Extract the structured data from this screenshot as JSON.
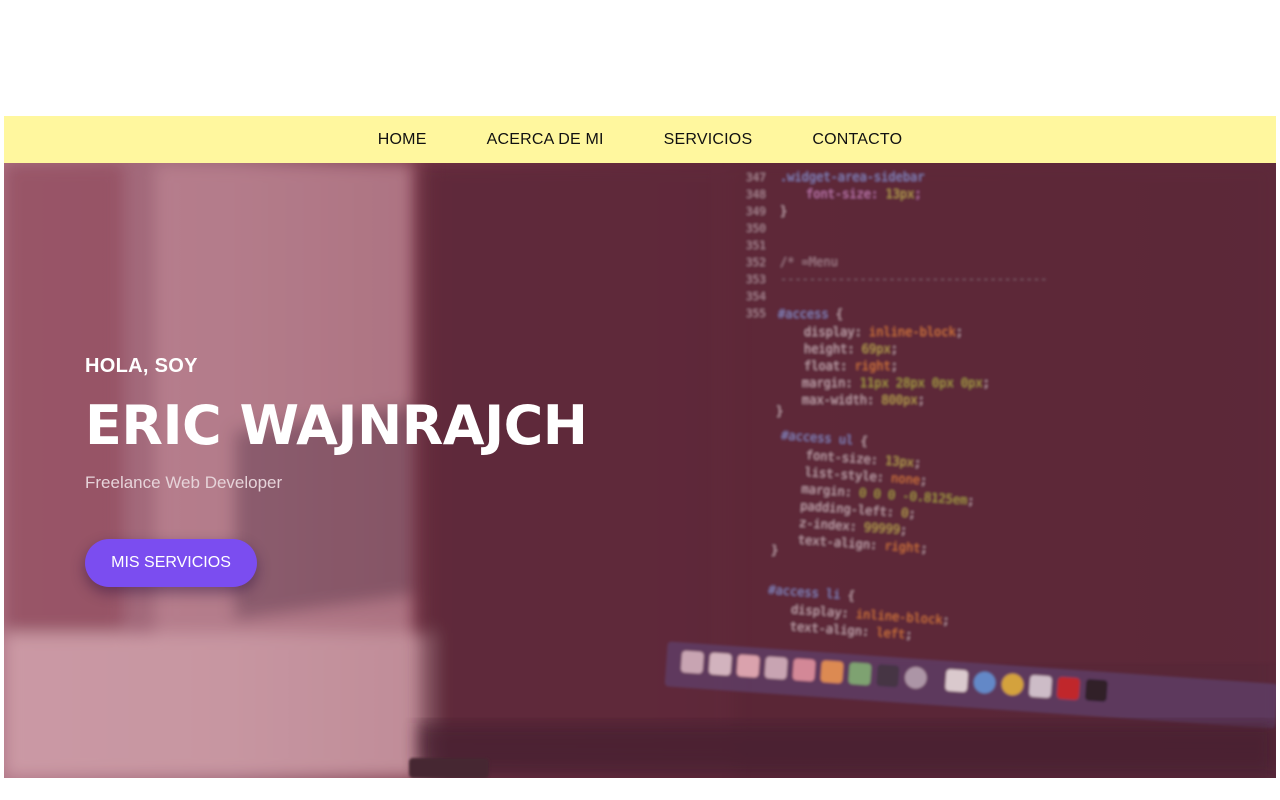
{
  "nav": {
    "items": [
      {
        "label": "HOME"
      },
      {
        "label": "ACERCA DE MI"
      },
      {
        "label": "SERVICIOS"
      },
      {
        "label": "CONTACTO"
      }
    ],
    "background": "#fff79e"
  },
  "hero": {
    "greeting": "HOLA, SOY",
    "name": "ERIC WAJNRAJCH",
    "role": "Freelance Web Developer",
    "cta_label": "MIS SERVICIOS",
    "cta_color": "#7b4df0",
    "tint_color": "#5e2d3c"
  }
}
